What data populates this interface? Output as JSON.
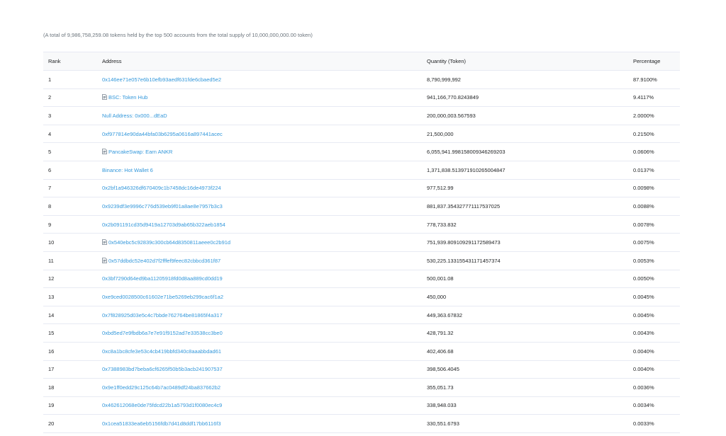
{
  "summary": "(A total of 9,986,758,259.08 tokens held by the top 500 accounts from the total supply of 10,000,000,000.00 token)",
  "table": {
    "headers": {
      "rank": "Rank",
      "address": "Address",
      "quantity": "Quantity (Token)",
      "percentage": "Percentage"
    },
    "rows": [
      {
        "rank": "1",
        "address": "0x146ee71e057e6b10efb93aedf631fde6cbaed5e2",
        "contract": false,
        "quantity": "8,790,999,992",
        "percentage": "87.9100%"
      },
      {
        "rank": "2",
        "address": "BSC: Token Hub",
        "contract": true,
        "quantity": "941,166,770.8243849",
        "percentage": "9.4117%"
      },
      {
        "rank": "3",
        "address": "Null Address: 0x000...dEaD",
        "contract": false,
        "quantity": "200,000,003.567593",
        "percentage": "2.0000%"
      },
      {
        "rank": "4",
        "address": "0xf977814e90da44bfa03b6295a0616a897441acec",
        "contract": false,
        "quantity": "21,500,000",
        "percentage": "0.2150%"
      },
      {
        "rank": "5",
        "address": "PancakeSwap: Earn ANKR",
        "contract": true,
        "quantity": "6,055,941.998158009346269203",
        "percentage": "0.0606%"
      },
      {
        "rank": "6",
        "address": "Binance: Hot Wallet 6",
        "contract": false,
        "quantity": "1,371,838.513971910265004847",
        "percentage": "0.0137%"
      },
      {
        "rank": "7",
        "address": "0x2bf1a946326df670409c1b7458dc16de4973f224",
        "contract": false,
        "quantity": "977,512.99",
        "percentage": "0.0098%"
      },
      {
        "rank": "8",
        "address": "0x9239df3e9996c776d539eb9f01a8ae8e7957b3c3",
        "contract": false,
        "quantity": "881,837.354327771117537025",
        "percentage": "0.0088%"
      },
      {
        "rank": "9",
        "address": "0x2b091191cd35d9419a12703d9ab65b322aeb1854",
        "contract": false,
        "quantity": "778,733.832",
        "percentage": "0.0078%"
      },
      {
        "rank": "10",
        "address": "0x540ebc5c92839c300cb64d8350811aeee0c2b91d",
        "contract": true,
        "quantity": "751,939.809109291172589473",
        "percentage": "0.0075%"
      },
      {
        "rank": "11",
        "address": "0x57ddbdc52e402d7f2fffef9feec82cbbcd361f87",
        "contract": true,
        "quantity": "530,225.133155431171457374",
        "percentage": "0.0053%"
      },
      {
        "rank": "12",
        "address": "0x3bf7290d64ed9ba11205918fd0d8aa889cd0dd19",
        "contract": false,
        "quantity": "500,001.08",
        "percentage": "0.0050%"
      },
      {
        "rank": "13",
        "address": "0xe9ced0028500c61602e71be5269eb299cac6f1a2",
        "contract": false,
        "quantity": "450,000",
        "percentage": "0.0045%"
      },
      {
        "rank": "14",
        "address": "0x7f828925d03e5c4c7bbde762764be81865f4a317",
        "contract": false,
        "quantity": "449,363.67832",
        "percentage": "0.0045%"
      },
      {
        "rank": "15",
        "address": "0xbd5ed7e9fbdb6a7e7e91f9152ad7e33538cc3be0",
        "contract": false,
        "quantity": "428,791.32",
        "percentage": "0.0043%"
      },
      {
        "rank": "16",
        "address": "0xc8a1bc8cfe3e53c4cb419bbfd340c8aaabbdad61",
        "contract": false,
        "quantity": "402,406.68",
        "percentage": "0.0040%"
      },
      {
        "rank": "17",
        "address": "0x7388983bd7beba6cf6265f50b5b3acb241907537",
        "contract": false,
        "quantity": "398,506.4045",
        "percentage": "0.0040%"
      },
      {
        "rank": "18",
        "address": "0x9e1ff0edd29c125c64b7ac0489df24ba837662b2",
        "contract": false,
        "quantity": "355,051.73",
        "percentage": "0.0036%"
      },
      {
        "rank": "19",
        "address": "0x462612068e0de75fdcd22b1a5793d1f0080ec4c9",
        "contract": false,
        "quantity": "338,948.033",
        "percentage": "0.0034%"
      },
      {
        "rank": "20",
        "address": "0x1cea51833ea6eb5156fdb7d41d8ddf17bb6116f3",
        "contract": false,
        "quantity": "330,551.6793",
        "percentage": "0.0033%"
      }
    ]
  },
  "colors": {
    "link": "#3498db",
    "text": "#1e2022",
    "muted": "#6c757d",
    "header_bg": "#f8f9fa",
    "border": "#e7eaf3"
  },
  "icons": {
    "contract": "file-contract-icon"
  }
}
